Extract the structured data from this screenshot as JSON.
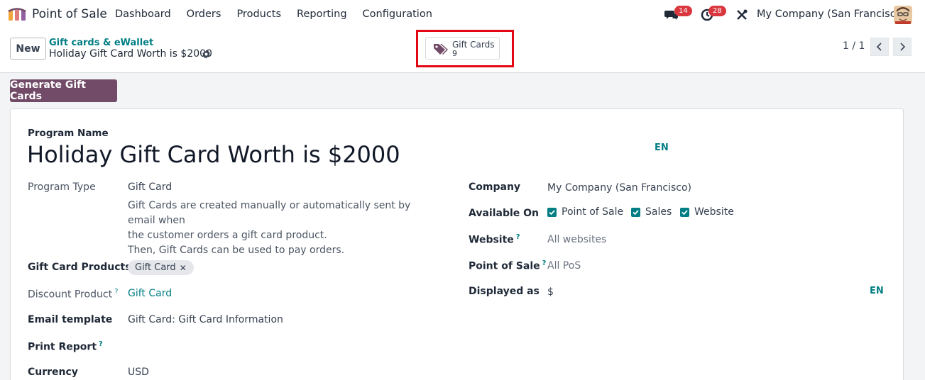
{
  "navbar": {
    "app_name": "Point of Sale",
    "menu": [
      "Dashboard",
      "Orders",
      "Products",
      "Reporting",
      "Configuration"
    ],
    "messages_count": "14",
    "activities_count": "28",
    "company": "My Company (San Francisco)"
  },
  "control": {
    "new_label": "New",
    "breadcrumb_parent": "Gift cards & eWallet",
    "breadcrumb_current": "Holiday Gift Card Worth is $2000",
    "smart_button": {
      "label": "Gift Cards",
      "value": "9"
    },
    "pager": "1 / 1"
  },
  "actions": {
    "generate_label": "Generate Gift Cards"
  },
  "form": {
    "program_name_label": "Program Name",
    "program_name": "Holiday Gift Card Worth is $2000",
    "lang_code": "EN",
    "program_type_label": "Program Type",
    "program_type": "Gift Card",
    "program_type_desc_1": "Gift Cards are created manually or automatically sent by email when",
    "program_type_desc_2": "the customer orders a gift card product.",
    "program_type_desc_3": "Then, Gift Cards can be used to pay orders.",
    "gift_card_products_label": "Gift Card Products",
    "gift_card_products_tag": "Gift Card",
    "discount_product_label": "Discount Product",
    "discount_product": "Gift Card",
    "email_template_label": "Email template",
    "email_template": "Gift Card: Gift Card Information",
    "print_report_label": "Print Report",
    "currency_label": "Currency",
    "currency": "USD",
    "company_label": "Company",
    "company": "My Company (San Francisco)",
    "available_on_label": "Available On",
    "available_on": [
      "Point of Sale",
      "Sales",
      "Website"
    ],
    "website_label": "Website",
    "website": "All websites",
    "pos_label": "Point of Sale",
    "pos": "All PoS",
    "displayed_as_label": "Displayed as",
    "displayed_as": "$",
    "help_mark": "?"
  },
  "colors": {
    "brand": "#714b67",
    "link": "#017e84",
    "badge": "#d9363e",
    "highlight": "#e30613"
  }
}
